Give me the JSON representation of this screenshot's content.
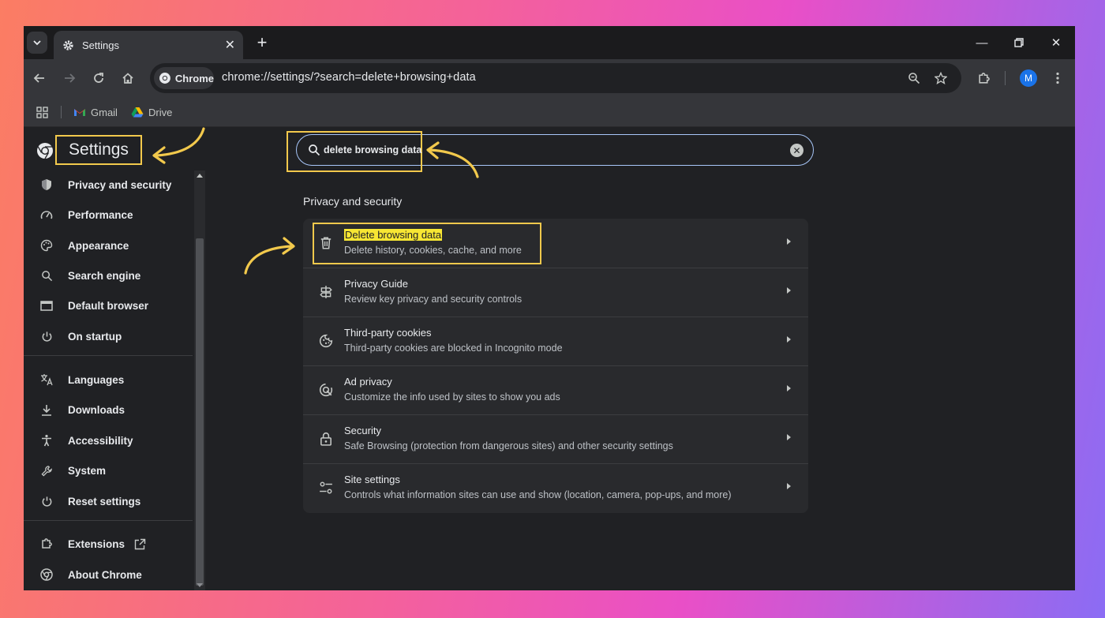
{
  "browser": {
    "tab": {
      "title": "Settings"
    },
    "address": {
      "chip": "Chrome",
      "url": "chrome://settings/?search=delete+browsing+data"
    },
    "bookmarks": [
      {
        "label": "Gmail"
      },
      {
        "label": "Drive"
      }
    ],
    "profile_initial": "M"
  },
  "settings": {
    "title": "Settings",
    "search": {
      "value": "delete browsing data"
    },
    "sidebar": [
      {
        "label": "Privacy and security",
        "icon": "shield-icon"
      },
      {
        "label": "Performance",
        "icon": "speedometer-icon"
      },
      {
        "label": "Appearance",
        "icon": "palette-icon"
      },
      {
        "label": "Search engine",
        "icon": "search-icon"
      },
      {
        "label": "Default browser",
        "icon": "browser-window-icon"
      },
      {
        "label": "On startup",
        "icon": "power-icon"
      },
      {
        "label": "Languages",
        "icon": "translate-icon"
      },
      {
        "label": "Downloads",
        "icon": "download-icon"
      },
      {
        "label": "Accessibility",
        "icon": "accessibility-icon"
      },
      {
        "label": "System",
        "icon": "wrench-icon"
      },
      {
        "label": "Reset settings",
        "icon": "reset-icon"
      },
      {
        "label": "Extensions",
        "icon": "puzzle-icon"
      },
      {
        "label": "About Chrome",
        "icon": "chrome-icon"
      }
    ],
    "section": "Privacy and security",
    "rows": [
      {
        "title": "Delete browsing data",
        "desc": "Delete history, cookies, cache, and more",
        "icon": "trash-icon"
      },
      {
        "title": "Privacy Guide",
        "desc": "Review key privacy and security controls",
        "icon": "signpost-icon"
      },
      {
        "title": "Third-party cookies",
        "desc": "Third-party cookies are blocked in Incognito mode",
        "icon": "cookie-icon"
      },
      {
        "title": "Ad privacy",
        "desc": "Customize the info used by sites to show you ads",
        "icon": "ad-privacy-icon"
      },
      {
        "title": "Security",
        "desc": "Safe Browsing (protection from dangerous sites) and other security settings",
        "icon": "lock-icon"
      },
      {
        "title": "Site settings",
        "desc": "Controls what information sites can use and show (location, camera, pop-ups, and more)",
        "icon": "sliders-icon"
      }
    ]
  },
  "colors": {
    "highlight_box": "#f2c94c",
    "search_match": "#f7e633",
    "accent": "#a8c7fa"
  }
}
